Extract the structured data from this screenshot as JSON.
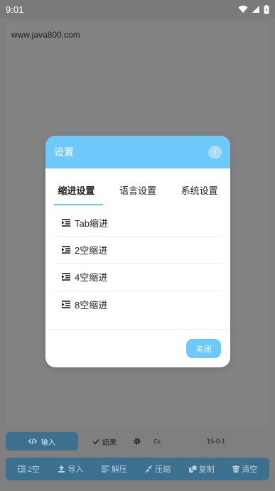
{
  "status_bar": {
    "time": "9:01"
  },
  "editor": {
    "url_text": "www.java800.com"
  },
  "toolbar1": {
    "input_label": "输入",
    "result_label": "结果",
    "cs_label": "Cs",
    "version": "15-0-1"
  },
  "toolbar2": {
    "items": [
      {
        "label": "2空",
        "icon": "indent-icon"
      },
      {
        "label": "导入",
        "icon": "upload-icon"
      },
      {
        "label": "解压",
        "icon": "decompress-icon"
      },
      {
        "label": "压缩",
        "icon": "compress-icon"
      },
      {
        "label": "复制",
        "icon": "copy-icon"
      },
      {
        "label": "清空",
        "icon": "trash-icon"
      }
    ]
  },
  "dialog": {
    "title": "设置",
    "info_icon": "!",
    "tabs": [
      {
        "label": "缩进设置",
        "active": true
      },
      {
        "label": "语言设置",
        "active": false
      },
      {
        "label": "系统设置",
        "active": false
      }
    ],
    "options": [
      {
        "label": "Tab缩进",
        "icon": "indent-icon"
      },
      {
        "label": "2空缩进",
        "icon": "indent-icon"
      },
      {
        "label": "4空缩进",
        "icon": "indent-icon"
      },
      {
        "label": "8空缩进",
        "icon": "indent-icon"
      }
    ],
    "close_label": "关闭"
  },
  "colors": {
    "accent": "#6ec9fb",
    "dim_overlay": "#7f7f7f",
    "toolbar_blue_dimmed": "#3d6f8f"
  }
}
